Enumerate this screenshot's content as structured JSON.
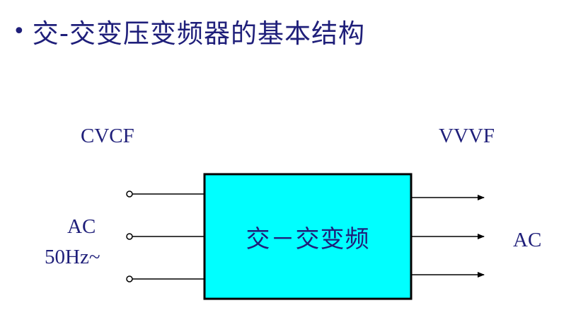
{
  "title": {
    "bullet": "•",
    "text": "交-交变压变频器的基本结构"
  },
  "input": {
    "top_label": "CVCF",
    "side_label_line1": "AC",
    "side_label_line2": "50Hz~",
    "terminal_count": 3
  },
  "output": {
    "top_label": "VVVF",
    "side_label": "AC",
    "arrow_count": 3
  },
  "converter": {
    "label": "交－交变频",
    "fill_color": "#00ffff",
    "border_color": "#000000"
  },
  "colors": {
    "text": "#1f1f7a",
    "lines": "#000000"
  }
}
